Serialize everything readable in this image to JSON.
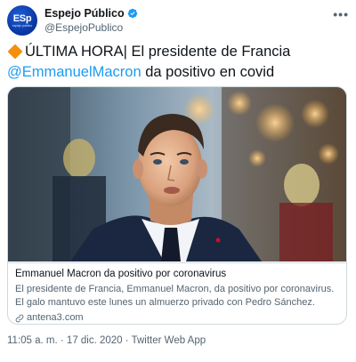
{
  "account": {
    "avatar_text": "ESp",
    "avatar_subtext": "espejo publico",
    "display_name": "Espejo Público",
    "handle": "@EspejoPublico",
    "more_label": "•••"
  },
  "tweet": {
    "text_part1": "ÚLTIMA HORA| El presidente de Francia",
    "mention": "@EmmanuelMacron",
    "text_part2": " da positivo en covid"
  },
  "card": {
    "title": "Emmanuel Macron da positivo por coronavirus",
    "description": "El presidente de Francia, Emmanuel Macron, da positivo por coronavirus. El galo mantuvo este lunes un almuerzo privado con Pedro Sánchez.",
    "domain": "antena3.com"
  },
  "meta": {
    "time": "11:05 a. m.",
    "separator1": " · ",
    "date": "17 dic. 2020",
    "separator2": " · ",
    "source": "Twitter Web App"
  },
  "colors": {
    "accent": "#1d9bf0",
    "verified": "#1d9bf0",
    "diamond": "#f4900c"
  },
  "icons": [
    "verified-badge-icon",
    "more-icon",
    "orange-diamond-icon",
    "link-icon"
  ]
}
